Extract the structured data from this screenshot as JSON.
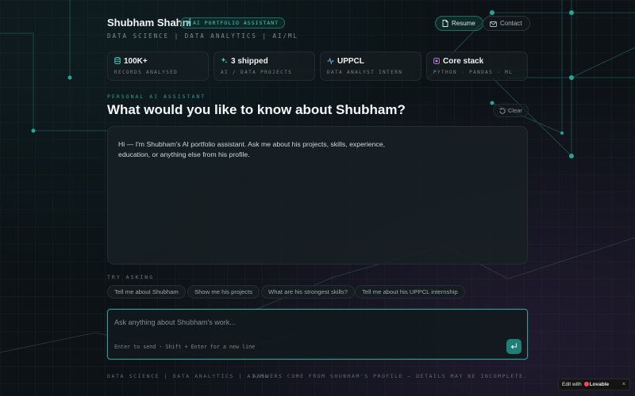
{
  "colors": {
    "accent": "#2aa396",
    "accent_text": "#3fd0bd",
    "background": "#0c1216",
    "panel": "#182025"
  },
  "header": {
    "name": "Shubham Shahni",
    "badge": "AI PORTFOLIO ASSISTANT",
    "subtitle": "DATA SCIENCE | DATA ANALYTICS | AI/ML",
    "resume_label": "Resume",
    "contact_label": "Contact"
  },
  "stats": [
    {
      "icon": "database-icon",
      "value": "100K+",
      "label": "RECORDS ANALYSED"
    },
    {
      "icon": "sparkles-icon",
      "value": "3 shipped",
      "label": "AI / DATA PROJECTS"
    },
    {
      "icon": "activity-icon",
      "value": "UPPCL",
      "label": "DATA ANALYST INTERN"
    },
    {
      "icon": "chip-icon",
      "value": "Core stack",
      "label": "PYTHON · PANDAS · ML"
    }
  ],
  "assistant": {
    "eyebrow": "PERSONAL AI ASSISTANT",
    "headline": "What would you like to know about Shubham?",
    "clear_label": "Clear"
  },
  "chat": {
    "messages": [
      {
        "role": "assistant",
        "text": "Hi — I'm Shubham's AI portfolio assistant. Ask me about his projects, skills, experience, education, or anything else from his profile."
      }
    ]
  },
  "suggestions": {
    "label": "TRY ASKING",
    "items": [
      "Tell me about Shubham",
      "Show me his projects",
      "What are his strongest skills?",
      "Tell me about his UPPCL internship"
    ]
  },
  "composer": {
    "placeholder": "Ask anything about Shubham's work...",
    "value": "",
    "hint": "Enter to send · Shift + Enter for a new line"
  },
  "footer": {
    "left": "DATA SCIENCE | DATA ANALYTICS | AI/ML",
    "right": "ANSWERS COME FROM SHUBHAM'S PROFILE — DETAILS MAY BE INCOMPLETE."
  },
  "lovable_badge": {
    "prefix": "Edit with",
    "brand": "Lovable",
    "close": "×"
  }
}
